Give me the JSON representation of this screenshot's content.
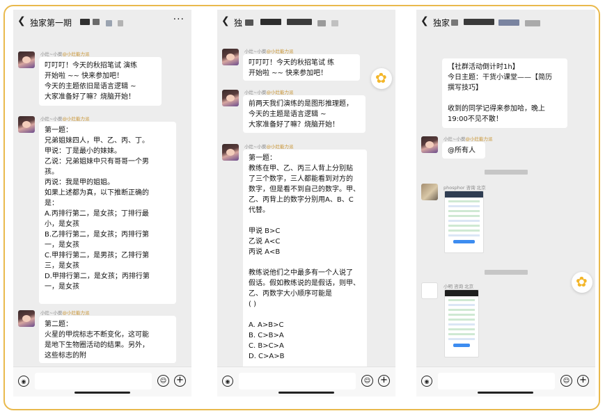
{
  "phones": [
    {
      "title": "独家第一期",
      "header_more": "···",
      "back_icon": "chevron-left-icon",
      "messages": [
        {
          "sender": "小灶~小葵",
          "tag": "@小灶能力派",
          "text": "叮叮叮！今天的秋招笔试  演练\n开始啦 ~~ 快来参加吧！\n今天的主题依旧是语言逻辑 ~\n大家准备好了嘛？烧脑开始！"
        },
        {
          "sender": "小灶~小葵",
          "tag": "@小灶能力派",
          "text": "第一题：\n兄弟姐妹四人，甲、乙、丙、丁。\n甲说：丁是最小的妹妹。\n乙说：兄弟姐妹中只有哥哥一个男\n孩。\n丙说：我是甲的姐姐。\n如果上述都为真，以下推断正确的\n是：\nA.丙排行第二，是女孩；丁排行最\n小，是女孩\nB.乙排行第二，是女孩；丙排行第\n一，是女孩\nC.甲排行第二，是男孩；乙排行第\n三，是女孩\nD.甲排行第二，是女孩；丙排行第\n一，是女孩"
        },
        {
          "sender": "小灶~小葵",
          "tag": "@小灶能力派",
          "text": "第二题：\n火星的甲烷标志不断变化，这可能\n是地下生物圈活动的结果。另外，\n这些标志的附"
        }
      ]
    },
    {
      "title": "独",
      "back_icon": "chevron-left-icon",
      "messages": [
        {
          "sender": "小灶~小葵",
          "tag": "@小灶能力派",
          "text": "叮叮叮！今天的秋招笔试    练\n开始啦 ~~ 快来参加吧！"
        },
        {
          "sender": "小灶~小葵",
          "tag": "@小灶能力派",
          "text": "前两天我们演练的是图形推理题，\n今天的主题是语言逻辑 ~\n大家准备好了嘛？烧脑开始！"
        },
        {
          "sender": "小灶~小葵",
          "tag": "@小灶能力派",
          "text": "第一题：\n教练在甲、乙、丙三人背上分别贴\n了三个数字，三人都能看到对方的\n数字，但是看不到自己的数字。甲、\n乙、丙背上的数字分别用A、B、C\n代替。\n\n甲说 B>C\n乙说 A<C\n丙说 A<B\n\n教练说他们之中最多有一个人说了\n假话。假如教练说的是假话，则甲、\n乙、丙数字大小顺序可能是\n(        )\n\nA.  A>B>C\nB.  C>B>A\nC.  B>C>A\nD.  C>A>B"
        }
      ]
    },
    {
      "title": "独家",
      "back_icon": "chevron-left-icon",
      "messages": [
        {
          "sender": "",
          "tag": "",
          "text": "【社群活动倒计时1h】\n今日主题：干货小课堂——【简历\n撰写技巧】\n\n收到的同学记得来参加哈，晚上\n19:00不见不散！"
        },
        {
          "sender": "小灶~小葵",
          "tag": "@小灶能力派",
          "text": "@所有人"
        },
        {
          "sender": "phosphor 咨询 北京",
          "tag": "",
          "text": ""
        },
        {
          "sender": "小明 咨询 北京",
          "tag": "",
          "text": ""
        }
      ]
    }
  ],
  "footer": {
    "voice_icon": "voice-icon",
    "emoji_icon": "emoji-icon",
    "plus_icon": "plus-icon"
  },
  "colors": {
    "frame": "#e9b94c",
    "chat_bg": "#ededed",
    "tag": "#c8932f"
  }
}
